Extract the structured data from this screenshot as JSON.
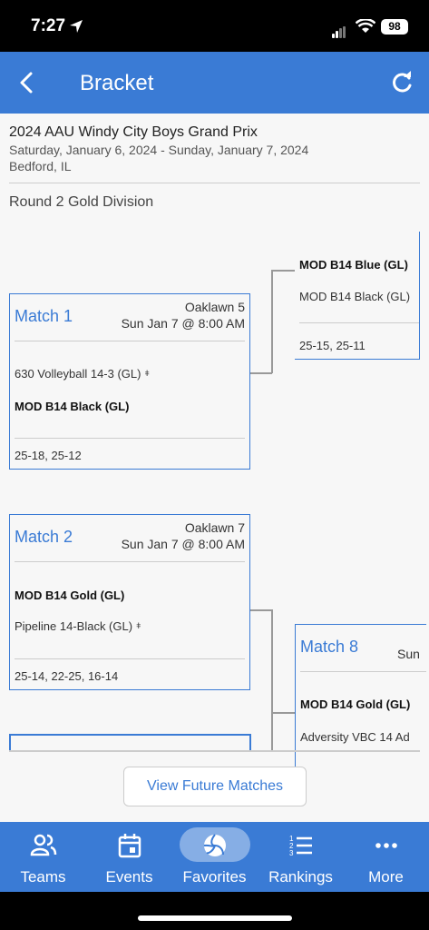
{
  "status_bar": {
    "time": "7:27",
    "battery": "98"
  },
  "header": {
    "title": "Bracket"
  },
  "event": {
    "title": "2024 AAU Windy City Boys Grand Prix",
    "dates": "Saturday, January 6, 2024  -  Sunday, January 7, 2024",
    "location": "Bedford, IL"
  },
  "round": "Round 2 Gold Division",
  "matches": [
    {
      "title": "Match 1",
      "court": "Oaklawn 5",
      "time": "Sun Jan 7 @ 8:00 AM",
      "team1": "630 Volleyball 14-3 (GL)",
      "team2": "MOD B14 Black (GL)",
      "scores": "25-18, 25-12"
    },
    {
      "title": "Match 2",
      "court": "Oaklawn 7",
      "time": "Sun Jan 7 @ 8:00 AM",
      "team1": "MOD B14 Gold (GL)",
      "team2": "Pipeline 14-Black (GL)",
      "scores": "25-14, 22-25, 16-14"
    }
  ],
  "next_round_top": {
    "team1": "MOD B14 Blue (GL)",
    "team2": "MOD B14 Black (GL)",
    "scores": "25-15, 25-11"
  },
  "match8": {
    "title": "Match 8",
    "time_partial": "Sun",
    "team1": "MOD B14 Gold (GL)",
    "team2": "Adversity VBC 14 Ad"
  },
  "seed_mark": "ǂ",
  "future_button": "View Future Matches",
  "tabs": [
    {
      "label": "Teams",
      "icon": "people-icon"
    },
    {
      "label": "Events",
      "icon": "calendar-icon"
    },
    {
      "label": "Favorites",
      "icon": "volleyball-icon"
    },
    {
      "label": "Rankings",
      "icon": "list-icon"
    },
    {
      "label": "More",
      "icon": "more-icon"
    }
  ],
  "colors": {
    "primary": "#3a7bd5",
    "favorite_highlight": "#86aee5",
    "background": "#f7f7f7"
  }
}
